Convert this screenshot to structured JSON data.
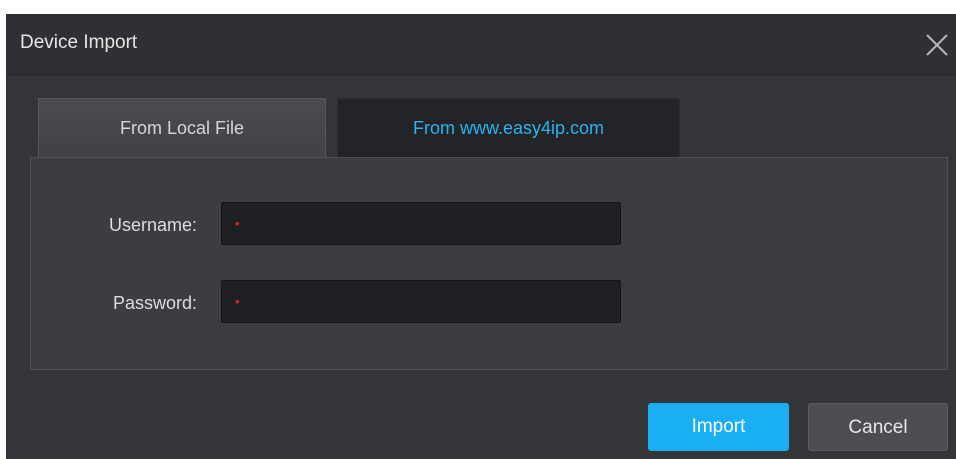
{
  "dialog": {
    "title": "Device Import",
    "close_icon": "close-icon"
  },
  "tabs": [
    {
      "label": "From Local File",
      "active": false
    },
    {
      "label": "From www.easy4ip.com",
      "active": true
    }
  ],
  "form": {
    "username": {
      "label": "Username:",
      "value": "",
      "required_marker": "•"
    },
    "password": {
      "label": "Password:",
      "value": "",
      "required_marker": "•"
    }
  },
  "buttons": {
    "import_label": "Import",
    "cancel_label": "Cancel"
  },
  "colors": {
    "accent": "#1aaff3",
    "active_tab_text": "#2ab3ee",
    "required": "#e0202a",
    "background": "#333538"
  }
}
